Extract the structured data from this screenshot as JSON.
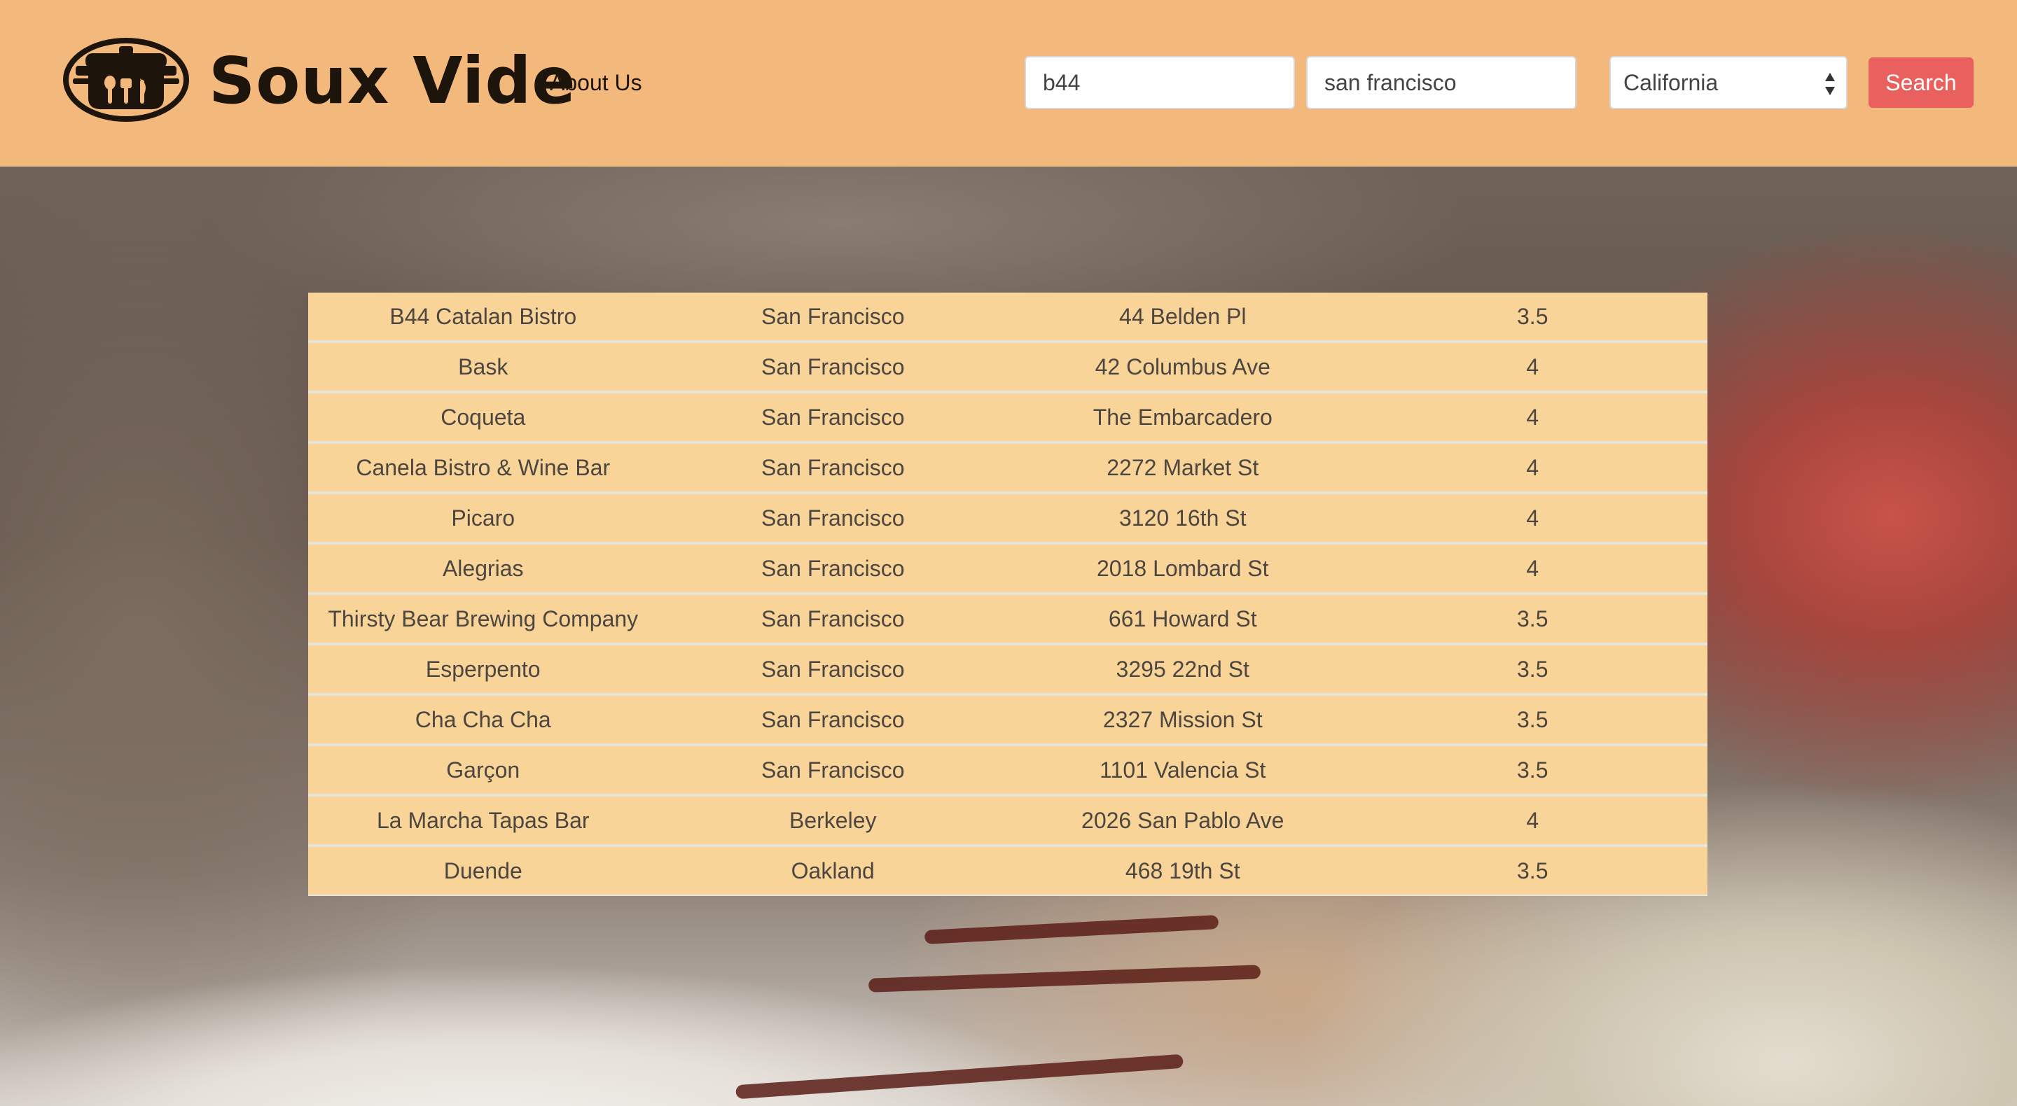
{
  "header": {
    "brand": "Soux Vide",
    "nav_about": "About Us",
    "logo_icon": "pot-with-utensils-icon",
    "brand_color": "#f3b87b"
  },
  "search": {
    "keyword_value": "b44",
    "city_value": "san francisco",
    "state_selected": "California",
    "button_label": "Search",
    "button_color": "#e9605e"
  },
  "results": {
    "row_color": "#f8d498",
    "rows": [
      {
        "name": "B44 Catalan Bistro",
        "city": "San Francisco",
        "address": "44 Belden Pl",
        "rating": "3.5"
      },
      {
        "name": "Bask",
        "city": "San Francisco",
        "address": "42 Columbus Ave",
        "rating": "4"
      },
      {
        "name": "Coqueta",
        "city": "San Francisco",
        "address": "The Embarcadero",
        "rating": "4"
      },
      {
        "name": "Canela Bistro & Wine Bar",
        "city": "San Francisco",
        "address": "2272 Market St",
        "rating": "4"
      },
      {
        "name": "Picaro",
        "city": "San Francisco",
        "address": "3120 16th St",
        "rating": "4"
      },
      {
        "name": "Alegrias",
        "city": "San Francisco",
        "address": "2018 Lombard St",
        "rating": "4"
      },
      {
        "name": "Thirsty Bear Brewing Company",
        "city": "San Francisco",
        "address": "661 Howard St",
        "rating": "3.5"
      },
      {
        "name": "Esperpento",
        "city": "San Francisco",
        "address": "3295 22nd St",
        "rating": "3.5"
      },
      {
        "name": "Cha Cha Cha",
        "city": "San Francisco",
        "address": "2327 Mission St",
        "rating": "3.5"
      },
      {
        "name": "Garçon",
        "city": "San Francisco",
        "address": "1101 Valencia St",
        "rating": "3.5"
      },
      {
        "name": "La Marcha Tapas Bar",
        "city": "Berkeley",
        "address": "2026 San Pablo Ave",
        "rating": "4"
      },
      {
        "name": "Duende",
        "city": "Oakland",
        "address": "468 19th St",
        "rating": "3.5"
      }
    ]
  }
}
